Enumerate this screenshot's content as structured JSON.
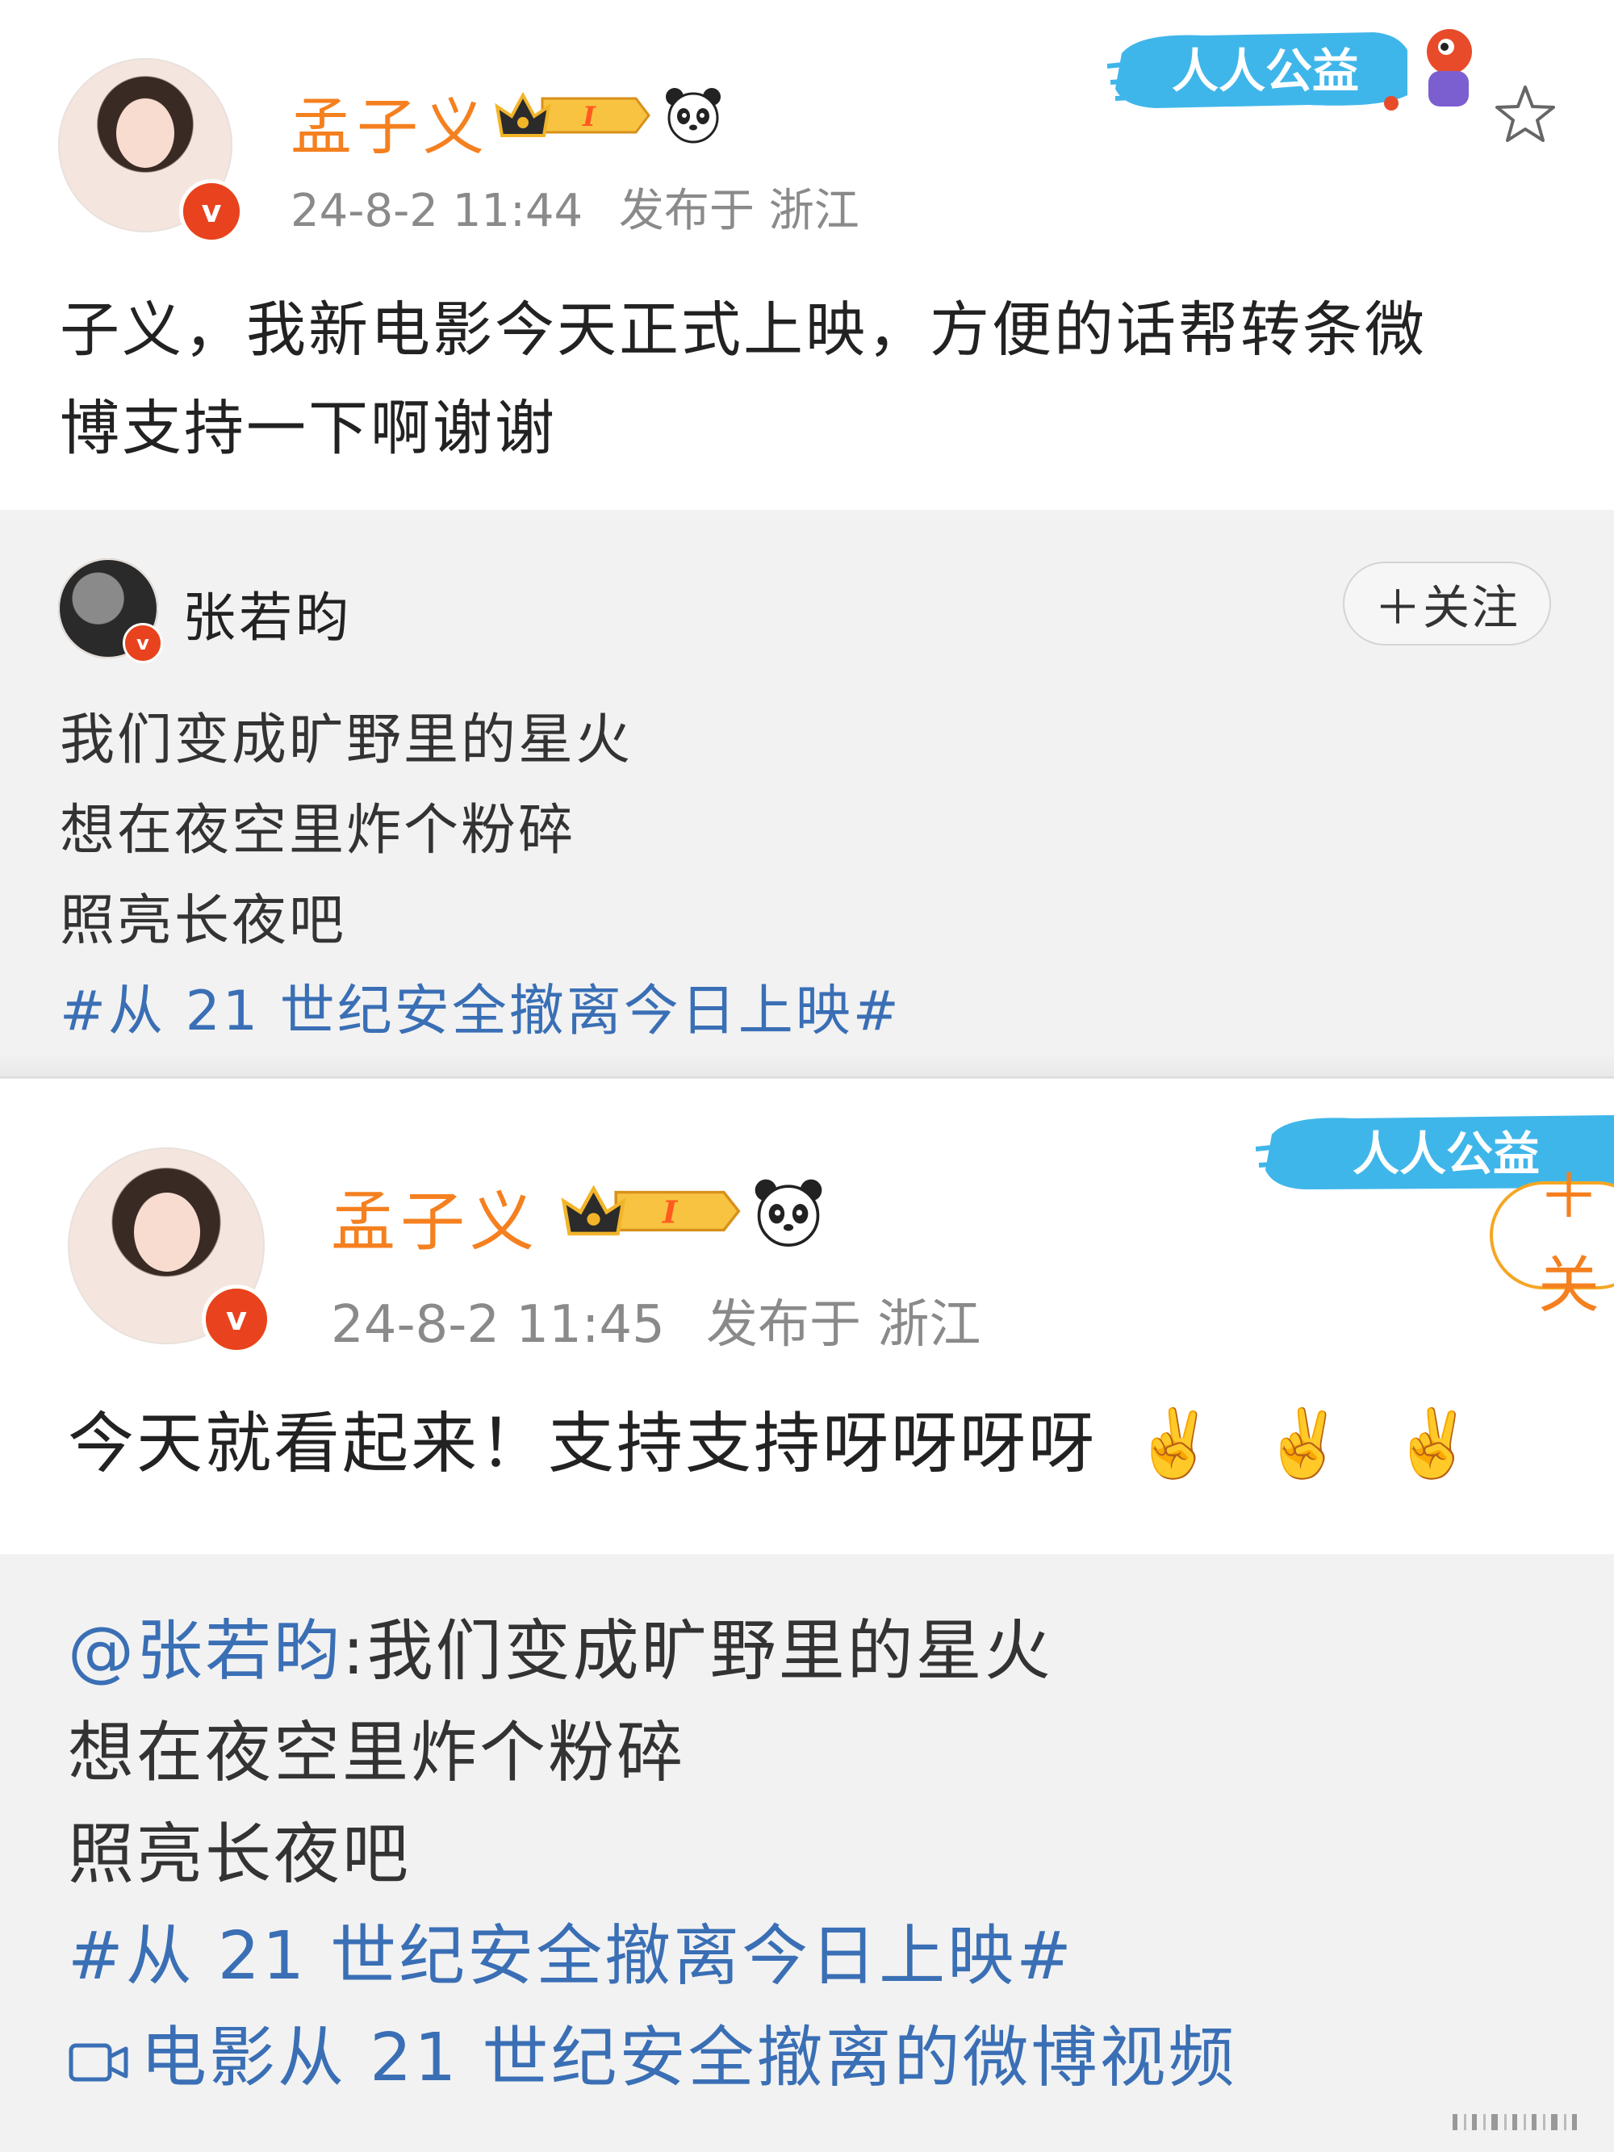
{
  "post1": {
    "username": "孟子义",
    "level_badge": "I",
    "timestamp": "24-8-2 11:44",
    "location_label": "发布于 浙江",
    "text": "子义，我新电影今天正式上映，方便的话帮转条微",
    "text_line2": "博支持一下啊谢谢",
    "banner_label": "人人公益",
    "repost": {
      "username": "张若昀",
      "follow_label": "＋关注",
      "lines": [
        "我们变成旷野里的星火",
        "想在夜空里炸个粉碎",
        "照亮长夜吧"
      ],
      "hashtag": "#从 21 世纪安全撤离今日上映#"
    }
  },
  "post2": {
    "username": "孟子义",
    "level_badge": "I",
    "timestamp": "24-8-2 11:45",
    "location_label": "发布于 浙江",
    "text": "今天就看起来！支持支持呀呀呀呀",
    "emoji": "✌️",
    "banner_label": "人人公益",
    "follow_label": "＋关",
    "repost": {
      "mention": "@张若昀",
      "line1_rest": ":我们变成旷野里的星火",
      "lines": [
        "想在夜空里炸个粉碎",
        "照亮长夜吧"
      ],
      "hashtag": "#从 21 世纪安全撤离今日上映#",
      "video_link": "电影从 21 世纪安全撤离的微博视频"
    }
  },
  "colors": {
    "username": "#f5801f",
    "link": "#3a6fb5",
    "meta": "#8a8a8a",
    "repost_bg": "#f2f2f2",
    "verified_badge": "#e8431e"
  },
  "icons": {
    "verified": "verified-v-icon",
    "crown": "crown-level-icon",
    "panda": "panda-icon",
    "star": "star-outline-icon",
    "video": "video-camera-icon",
    "victory": "victory-hand-emoji"
  }
}
